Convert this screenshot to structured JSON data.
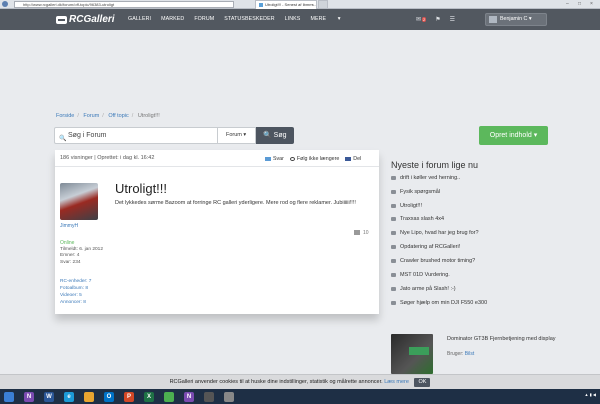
{
  "browser": {
    "url": "http://www.rcgalleri.dk/forum/off-topic/96383-utroligt",
    "tab_title": "Utroligt!!! - Senest af Ibmm..."
  },
  "nav": {
    "logo_text": "RCGalleri",
    "links": [
      "GALLERI",
      "MARKED",
      "FORUM",
      "STATUSBESKEDER",
      "LINKS",
      "MERE"
    ],
    "mail_count": "2",
    "user_name": "Benjamin C"
  },
  "breadcrumb": [
    "Forside",
    "Forum",
    "Off topic",
    "Utroligt!!!"
  ],
  "search": {
    "placeholder": "Søg i Forum",
    "scope": "Forum",
    "button": "Søg"
  },
  "create_button": "Opret indhold",
  "post": {
    "views_text": "186 visninger | Oprettet: i dag kl. 16:42",
    "actions": [
      "Svar",
      "Følg ikke længere",
      "Del"
    ],
    "title": "Utroligt!!!",
    "body": "Det lykkedes sørme Bazoom at forringe RC galleri yderligere. Mere rod og flere reklamer. Jubiiiiii!!!!",
    "likes": "10",
    "author": {
      "name": "JimmyH",
      "status": "Online",
      "meta": [
        "Tilmeldt: 6. jan 2012",
        "Emner: 4",
        "Svar: 234"
      ],
      "stats": [
        "RC-enheder: 7",
        "Fotoalbum: 8",
        "Videoer: 5",
        "Annoncer: 8"
      ]
    }
  },
  "sidebar": {
    "heading": "Nyeste i forum lige nu",
    "items": [
      "drift i køller ved herning..",
      "Fysik spørgsmål",
      "Utroligt!!!",
      "Traxxas slash 4x4",
      "Nye Lipo, hvad har jeg brug for?",
      "Opdatering af RCGalleri!",
      "Crawler brushed motor timing?",
      "MST 01D Vurdering.",
      "Jato arme på Slash! :-)",
      "Søger hjælp om min DJI F550 e300"
    ],
    "promo": {
      "title": "Dominator GT3B Fjernbetjening med display",
      "seller_label": "Bruger:",
      "seller": "Bilst"
    }
  },
  "cookie": {
    "text": "RCGalleri anvender cookies til at huske dine indstillinger, statistik og målrette annoncer.",
    "link": "Læs mere",
    "ok": "OK"
  }
}
